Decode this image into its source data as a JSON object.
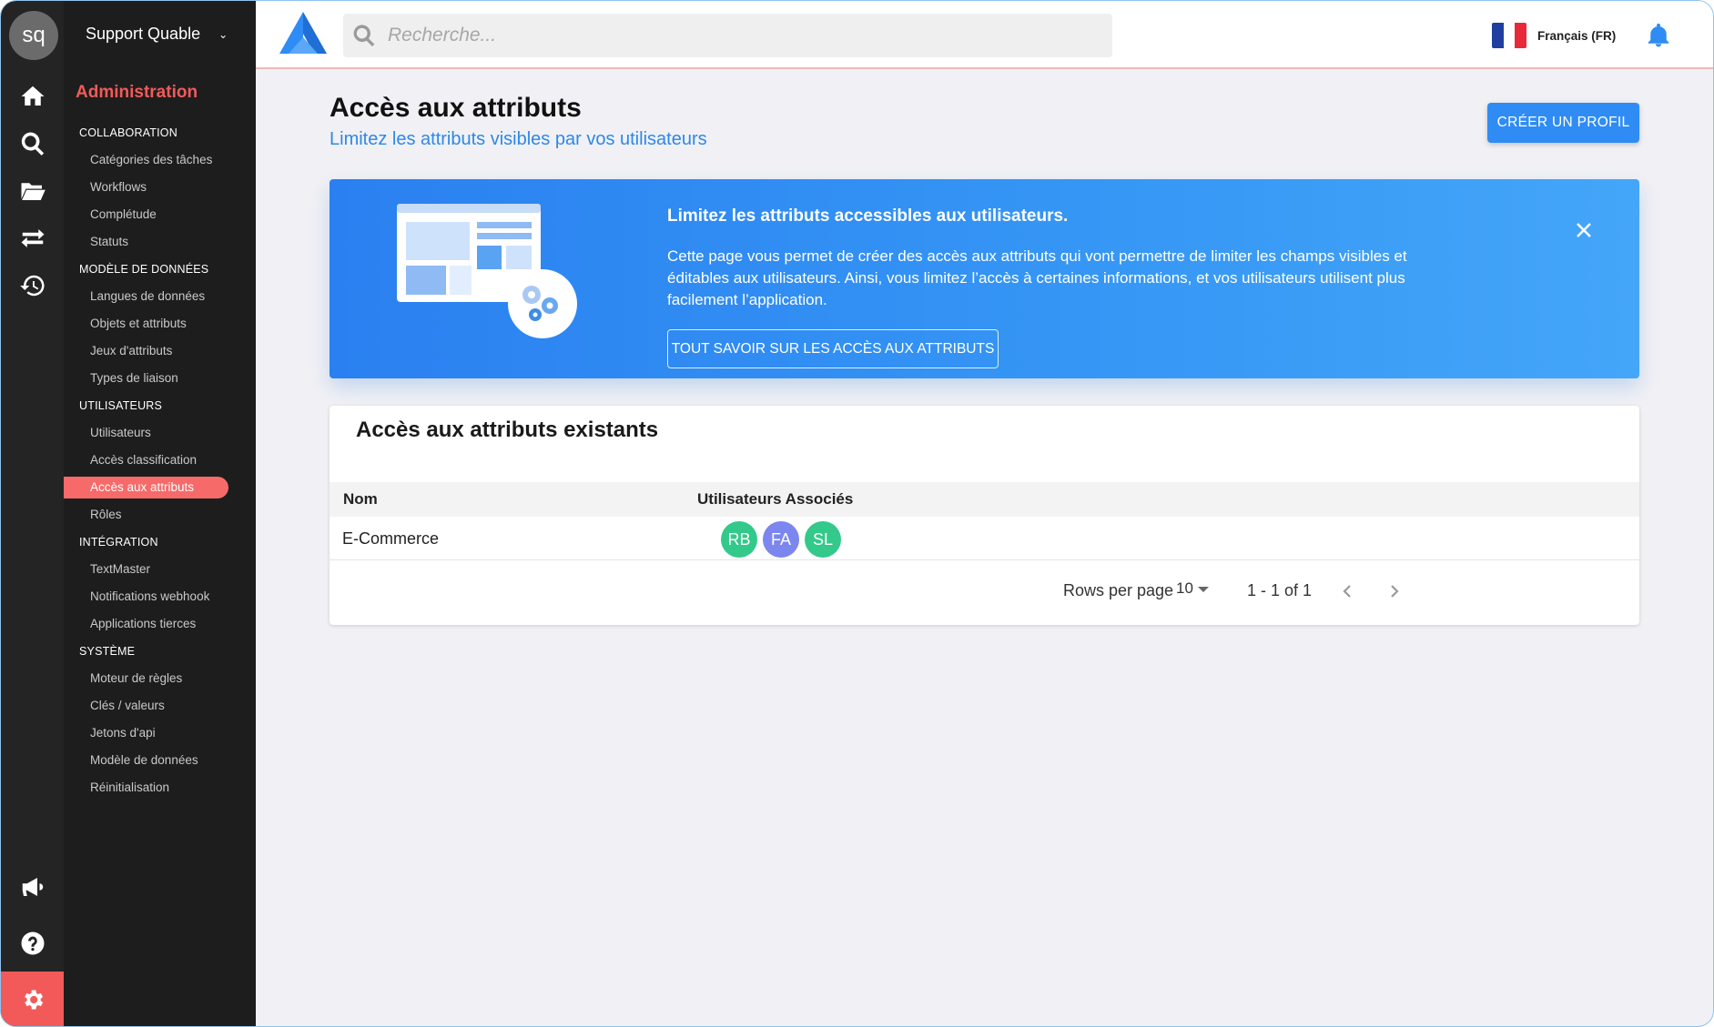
{
  "rail": {
    "avatar_initials": "sq",
    "icons": [
      "home-icon",
      "search-icon",
      "folder-icon",
      "transfer-icon",
      "history-icon",
      "megaphone-icon",
      "help-icon",
      "settings-icon"
    ]
  },
  "sidebar": {
    "account_name": "Support Quable",
    "section_title": "Administration",
    "sections": [
      {
        "label": "COLLABORATION",
        "items": [
          "Catégories des tâches",
          "Workflows",
          "Complétude",
          "Statuts"
        ]
      },
      {
        "label": "MODÈLE DE DONNÉES",
        "items": [
          "Langues de données",
          "Objets et attributs",
          "Jeux d'attributs",
          "Types de liaison"
        ]
      },
      {
        "label": "UTILISATEURS",
        "items": [
          "Utilisateurs",
          "Accès classification",
          "Accès aux attributs",
          "Rôles"
        ]
      },
      {
        "label": "INTÉGRATION",
        "items": [
          "TextMaster",
          "Notifications webhook",
          "Applications tierces"
        ]
      },
      {
        "label": "SYSTÈME",
        "items": [
          "Moteur de règles",
          "Clés / valeurs",
          "Jetons d'api",
          "Modèle de données",
          "Réinitialisation"
        ]
      }
    ],
    "active_item": "Accès aux attributs"
  },
  "topbar": {
    "search_placeholder": "Recherche...",
    "language": "Français (FR)"
  },
  "page": {
    "title": "Accès aux attributs",
    "subtitle": "Limitez les attributs visibles par vos utilisateurs",
    "create_button": "CRÉER UN PROFIL"
  },
  "banner": {
    "title": "Limitez les attributs accessibles aux utilisateurs.",
    "text": "Cette page vous permet de créer des accès aux attributs qui vont permettre de limiter les champs visibles et éditables aux utilisateurs. Ainsi, vous limitez l’accès à certaines informations, et vos utilisateurs utilisent plus facilement l’application.",
    "button": "TOUT SAVOIR SUR LES ACCÈS AUX ATTRIBUTS"
  },
  "table": {
    "title": "Accès aux attributs existants",
    "columns": [
      "Nom",
      "Utilisateurs Associés"
    ],
    "rows": [
      {
        "name": "E-Commerce",
        "users": [
          {
            "initials": "RB",
            "color": "#33c98a"
          },
          {
            "initials": "FA",
            "color": "#7b86ef"
          },
          {
            "initials": "SL",
            "color": "#33c98a"
          }
        ]
      }
    ],
    "rows_per_page_label": "Rows per page",
    "rows_per_page": "10",
    "range": "1 - 1 of 1"
  },
  "colors": {
    "accent": "#2f8cf5",
    "active": "#f76a6a",
    "admin_title": "#f25a5a"
  }
}
